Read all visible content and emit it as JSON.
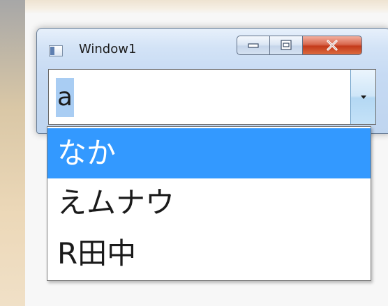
{
  "window": {
    "title": "Window1",
    "buttons": {
      "minimize": "minimize-icon",
      "maximize": "maximize-icon",
      "close": "close-icon"
    }
  },
  "combobox": {
    "value": "a",
    "arrow_icon": "chevron-down-icon"
  },
  "dropdown": {
    "items": [
      {
        "label": "なか",
        "selected": true
      },
      {
        "label": "えムナウ",
        "selected": false
      },
      {
        "label": "R田中",
        "selected": false
      }
    ]
  },
  "colors": {
    "selection": "#3399ff",
    "text_highlight": "#a9cdf3",
    "close_button": "#c43a1b"
  }
}
